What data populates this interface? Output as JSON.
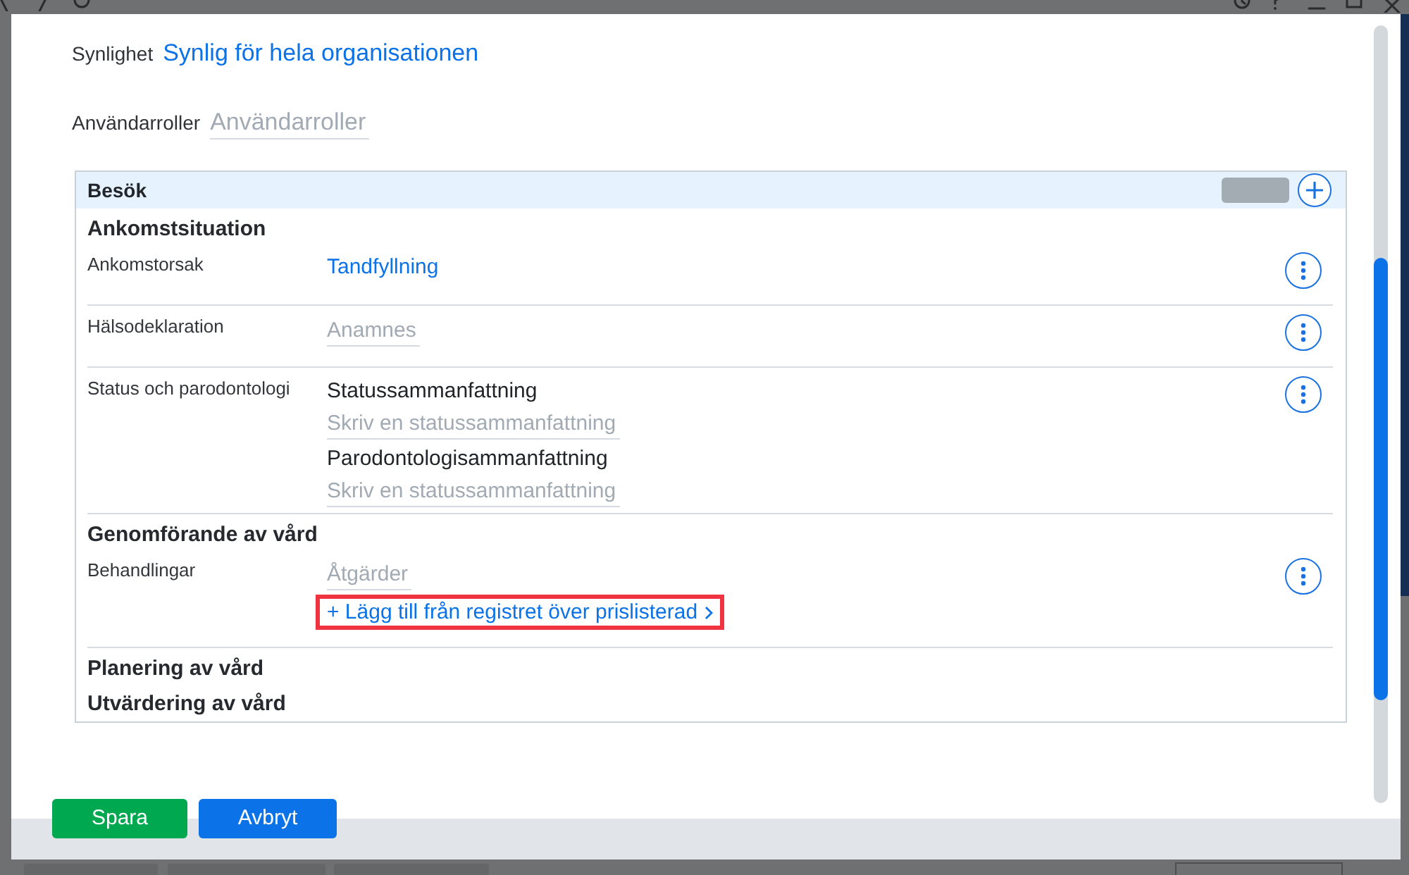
{
  "dialog": {
    "fields": [
      {
        "kind": "link",
        "label": "Synlighet",
        "value": "Synlig för hela organisationen"
      },
      {
        "kind": "input",
        "label": "Användarroller",
        "placeholder": "Användarroller"
      }
    ],
    "panel": {
      "title": "Besök",
      "sections": [
        {
          "title": "Ankomstsituation",
          "rows": [
            {
              "label": "Ankomstorsak",
              "entries": [
                {
                  "kind": "link",
                  "text": "Tandfyllning"
                }
              ]
            },
            {
              "label": "Hälsodeklaration",
              "entries": [
                {
                  "kind": "input",
                  "placeholder": "Anamnes"
                }
              ]
            },
            {
              "label": "Status och parodontologi",
              "entries": [
                {
                  "kind": "subheading",
                  "text": "Statussammanfattning"
                },
                {
                  "kind": "input",
                  "placeholder": "Skriv en statussammanfattning"
                },
                {
                  "kind": "subheading",
                  "text": "Parodontologisammanfattning"
                },
                {
                  "kind": "input",
                  "placeholder": "Skriv en statussammanfattning"
                }
              ]
            }
          ]
        },
        {
          "title": "Genomförande av vård",
          "rows": [
            {
              "label": "Behandlingar",
              "entries": [
                {
                  "kind": "input",
                  "placeholder": "Åtgärder"
                },
                {
                  "kind": "action",
                  "text": "+ Lägg till från registret över prislisterad",
                  "highlighted": true
                }
              ]
            }
          ]
        },
        {
          "title": "Planering av vård"
        },
        {
          "title": "Utvärdering av vård"
        }
      ]
    },
    "buttons": [
      {
        "kind": "success",
        "label": "Spara"
      },
      {
        "kind": "primary",
        "label": "Avbryt"
      }
    ]
  }
}
